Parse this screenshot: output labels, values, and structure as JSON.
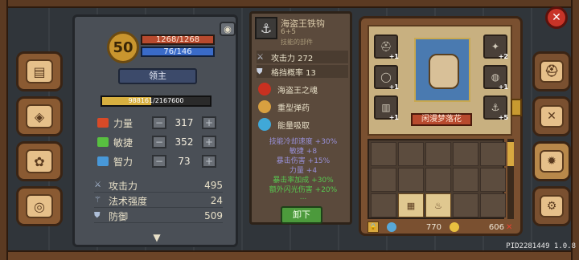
{
  "character": {
    "level": "50",
    "hp": "1268/1268",
    "mp": "76/146",
    "title": "领主",
    "exp": "988161/2167600",
    "exp_fraction": 0.456,
    "stats": [
      {
        "label": "力量",
        "value": "317",
        "color": "#d84a28"
      },
      {
        "label": "敏捷",
        "value": "352",
        "color": "#58c040"
      },
      {
        "label": "智力",
        "value": "73",
        "color": "#4898d8"
      }
    ],
    "derived": [
      {
        "label": "攻击力",
        "value": "495",
        "icon": "sword-icon"
      },
      {
        "label": "法术强度",
        "value": "24",
        "icon": "wand-icon"
      },
      {
        "label": "防御",
        "value": "509",
        "icon": "shield-icon"
      }
    ]
  },
  "item": {
    "name": "海盗王铁钩",
    "sub": "6+5",
    "note": "技能的部件",
    "stats": [
      {
        "label": "攻击力 272",
        "icon": "sword-icon"
      },
      {
        "label": "格挡概率 13",
        "icon": "shield-icon"
      }
    ],
    "skills": [
      {
        "label": "海盗王之魂",
        "color": "#c83020",
        "icon": "flame-icon"
      },
      {
        "label": "重型弹药",
        "color": "#d8a040",
        "icon": "ammo-icon"
      },
      {
        "label": "能量吸取",
        "color": "#40a8d8",
        "icon": "energy-icon"
      }
    ],
    "bonuses": [
      {
        "text": "技能冷却速度 +30%",
        "color": "#9890d8"
      },
      {
        "text": "敏捷 +8",
        "color": "#9890d8"
      },
      {
        "text": "暴击伤害 +15%",
        "color": "#9890d8"
      },
      {
        "text": "力量 +4",
        "color": "#9890d8"
      },
      {
        "text": "暴击率加成 +30%",
        "color": "#58c850"
      },
      {
        "text": "额外闪光伤害 +20%",
        "color": "#58c850"
      },
      {
        "text": "...",
        "color": "#58c850"
      }
    ],
    "unequip_label": "卸下"
  },
  "equipment": {
    "pet_name": "闲漫梦落花",
    "slots": [
      {
        "badge": "+1",
        "icon": "helmet-icon"
      },
      {
        "badge": "+1",
        "icon": "amulet-icon"
      },
      {
        "badge": "+1",
        "icon": "armor-icon"
      },
      {
        "badge": "+2",
        "icon": "gem-icon"
      },
      {
        "badge": "+1",
        "icon": "ring-icon"
      },
      {
        "badge": "+5",
        "icon": "hook-icon"
      }
    ]
  },
  "inventory": {
    "items": [
      "scroll-icon",
      "potion-icon"
    ]
  },
  "currency": {
    "gems": "770",
    "coins": "606"
  },
  "footer": {
    "pid": "PID2281449 1.0.8"
  },
  "colors": {
    "accent_gold": "#c9952e",
    "hp_red": "#b84a2e",
    "mp_blue": "#3a6bc8",
    "unequip_green": "#4c9a3c"
  }
}
